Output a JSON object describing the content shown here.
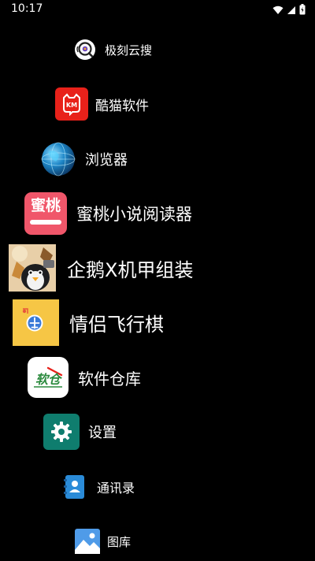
{
  "status_bar": {
    "time": "10:17",
    "icons": [
      "wifi-icon",
      "signal-icon",
      "battery-icon"
    ]
  },
  "apps": [
    {
      "label": "极刻云搜",
      "icon": "jike-search-icon"
    },
    {
      "label": "酷猫软件",
      "icon": "kumao-km-icon",
      "icon_text": "KM"
    },
    {
      "label": "浏览器",
      "icon": "globe-browser-icon"
    },
    {
      "label": "蜜桃小说阅读器",
      "icon": "mitao-novel-icon",
      "icon_text": "蜜桃"
    },
    {
      "label": "企鹅X机甲组装",
      "icon": "penguin-mecha-icon"
    },
    {
      "label": "情侣飞行棋",
      "icon": "flying-chess-icon"
    },
    {
      "label": "软件仓库",
      "icon": "software-warehouse-icon",
      "icon_text": "软仓"
    },
    {
      "label": "设置",
      "icon": "gear-icon"
    },
    {
      "label": "通讯录",
      "icon": "contacts-icon"
    },
    {
      "label": "图库",
      "icon": "gallery-icon"
    }
  ],
  "colors": {
    "background": "#000000",
    "text": "#ffffff",
    "kumao_red": "#e8211a",
    "mitao_pink": "#f0566a",
    "chess_yellow": "#f6c645",
    "settings_teal": "#0f7d6e",
    "contacts_blue": "#2a8bd8",
    "gallery_blue": "#4f9be8"
  }
}
